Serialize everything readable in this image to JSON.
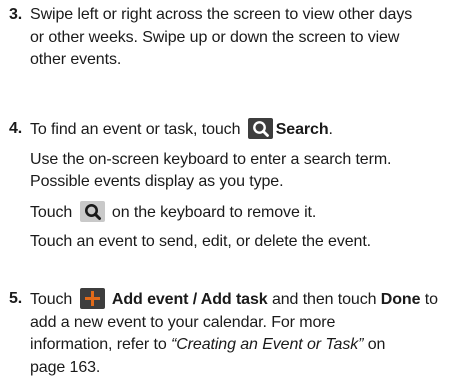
{
  "steps": [
    {
      "num": "3.",
      "lines": [
        "Swipe left or right across the screen to view other days",
        "or other weeks. Swipe up or down the screen to view",
        "other events."
      ]
    },
    {
      "num": "4.",
      "intro_before": "To find an event or task, touch",
      "intro_bold": "Search",
      "intro_after": ".",
      "para1_lines": [
        "Use the on-screen keyboard to enter a search term.",
        "Possible events display as you type."
      ],
      "para2_before": "Touch",
      "para2_after": "on the keyboard to remove it.",
      "para3": "Touch an event to send, edit, or delete the event."
    },
    {
      "num": "5.",
      "l1_before": "Touch",
      "l1_bold1": "Add event / Add task",
      "l1_mid": "and then touch",
      "l1_bold2": "Done",
      "l1_after": "to",
      "l2": "add a new event to your calendar. For more",
      "l3_before": "information, refer to",
      "l3_italic": "“Creating an Event or Task”",
      "l3_after": "on",
      "l4": "page 163."
    }
  ],
  "icons": {
    "search": "search-icon",
    "keyboard_search": "keyboard-search-key-icon",
    "add": "add-icon"
  },
  "colors": {
    "text": "#1a1a1a",
    "search_icon_bg": "#3d3d3d",
    "key_icon_bg": "#c9c9c9",
    "add_icon_bg": "#3d3d3d",
    "add_icon_plus": "#e06a1a"
  }
}
